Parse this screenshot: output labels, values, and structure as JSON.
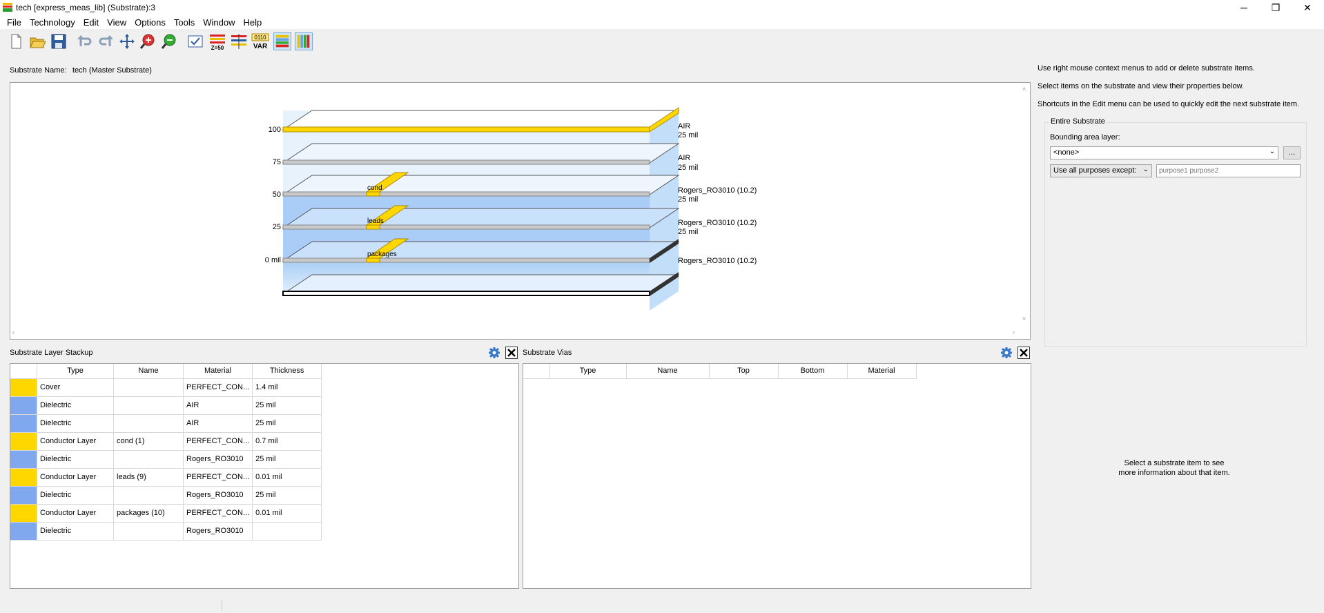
{
  "window": {
    "title": "tech [express_meas_lib] (Substrate):3",
    "minimize_glyph": "─",
    "restore_glyph": "❐",
    "close_glyph": "✕"
  },
  "menu": [
    {
      "label": "File"
    },
    {
      "label": "Technology"
    },
    {
      "label": "Edit"
    },
    {
      "label": "View"
    },
    {
      "label": "Options"
    },
    {
      "label": "Tools"
    },
    {
      "label": "Window"
    },
    {
      "label": "Help"
    }
  ],
  "toolbar": {
    "icons": [
      "new-document-icon",
      "open-folder-icon",
      "save-icon",
      "undo-icon",
      "redo-icon",
      "pan-icon",
      "zoom-in-icon",
      "zoom-out-icon",
      "check-icon",
      "z-level-icon",
      "layers-icon",
      "variables-icon",
      "horizontal-layers-icon",
      "vertical-layers-icon"
    ],
    "z_label": "Z=50",
    "var_top": "0110",
    "var_bottom": "VAR"
  },
  "substrate": {
    "name_label": "Substrate Name:",
    "name_value": "tech (Master Substrate)"
  },
  "diagram": {
    "ticks": [
      "100",
      "75",
      "50",
      "25",
      "0 mil"
    ],
    "layer_labels": [
      "cond",
      "leads",
      "packages"
    ],
    "right_labels": [
      {
        "material": "AIR",
        "thickness": "25 mil"
      },
      {
        "material": "AIR",
        "thickness": "25 mil"
      },
      {
        "material": "Rogers_RO3010 (10.2)",
        "thickness": "25 mil"
      },
      {
        "material": "Rogers_RO3010 (10.2)",
        "thickness": "25 mil"
      },
      {
        "material": "Rogers_RO3010 (10.2)",
        "thickness": ""
      }
    ]
  },
  "stackup": {
    "title": "Substrate Layer Stackup",
    "columns": [
      "Type",
      "Name",
      "Material",
      "Thickness"
    ],
    "rows": [
      {
        "color": "#ffd700",
        "type": "Cover",
        "name": "",
        "material": "PERFECT_CON...",
        "thickness": "1.4 mil"
      },
      {
        "color": "#7fa8ee",
        "type": "Dielectric",
        "name": "",
        "material": "AIR",
        "thickness": "25 mil"
      },
      {
        "color": "#7fa8ee",
        "type": "Dielectric",
        "name": "",
        "material": "AIR",
        "thickness": "25 mil"
      },
      {
        "color": "#ffd700",
        "type": "Conductor Layer",
        "name": "cond (1)",
        "material": "PERFECT_CON...",
        "thickness": "0.7 mil"
      },
      {
        "color": "#7fa8ee",
        "type": "Dielectric",
        "name": "",
        "material": "Rogers_RO3010",
        "thickness": "25 mil"
      },
      {
        "color": "#ffd700",
        "type": "Conductor Layer",
        "name": "leads (9)",
        "material": "PERFECT_CON...",
        "thickness": "0.01 mil"
      },
      {
        "color": "#7fa8ee",
        "type": "Dielectric",
        "name": "",
        "material": "Rogers_RO3010",
        "thickness": "25 mil"
      },
      {
        "color": "#ffd700",
        "type": "Conductor Layer",
        "name": "packages (10)",
        "material": "PERFECT_CON...",
        "thickness": "0.01 mil"
      },
      {
        "color": "#7fa8ee",
        "type": "Dielectric",
        "name": "",
        "material": "Rogers_RO3010",
        "thickness": ""
      }
    ]
  },
  "vias": {
    "title": "Substrate Vias",
    "columns": [
      "Type",
      "Name",
      "Top",
      "Bottom",
      "Material"
    ]
  },
  "help": {
    "line1": "Use right mouse context menus to add or delete substrate items.",
    "line2": "Select items on the substrate and view their properties below.",
    "line3": "Shortcuts in the Edit menu can be used to quickly edit the next substrate item."
  },
  "entire_substrate": {
    "group_title": "Entire Substrate",
    "bounding_label": "Bounding area layer:",
    "bounding_value": "<none>",
    "browse_label": "...",
    "purposes_mode": "Use all purposes except:",
    "purposes_placeholder": "purpose1 purpose2"
  },
  "info": {
    "line1": "Select a substrate item to see",
    "line2": "more information about that item."
  },
  "colors": {
    "conductor": "#ffd700",
    "dielectric": "#7fa8ee",
    "gear": "#3a78c8"
  }
}
